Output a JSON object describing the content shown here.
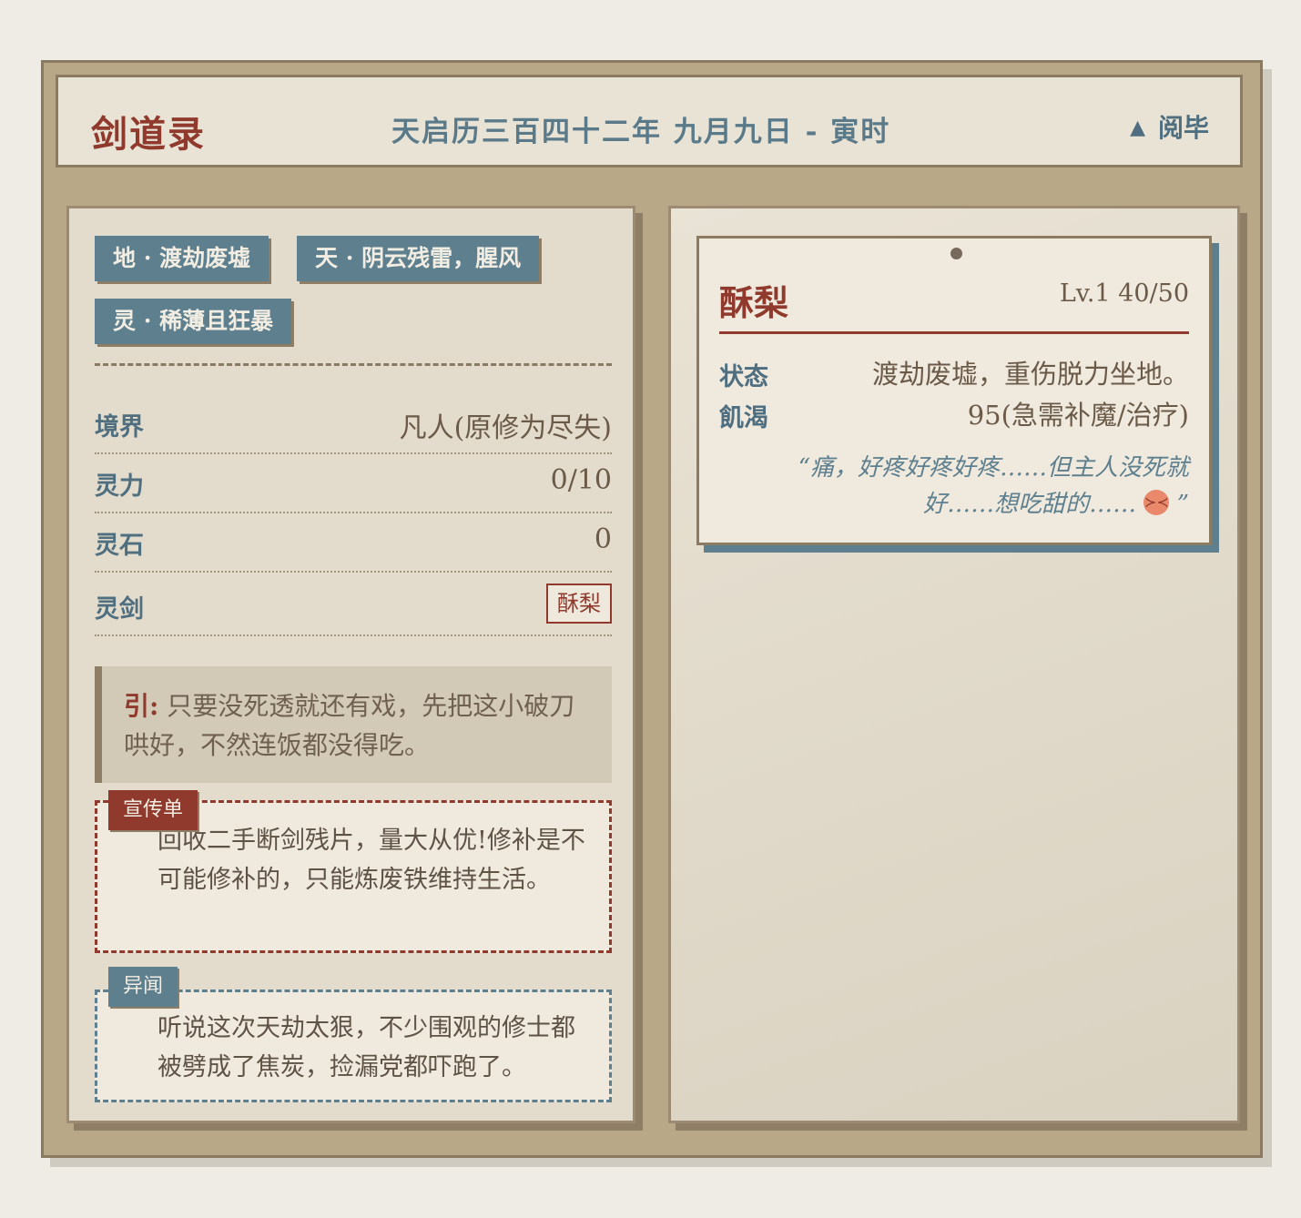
{
  "header": {
    "app_title": "剑道录",
    "date": "天启历三百四十二年 九月九日 - 寅时",
    "close_label": "阅毕",
    "close_icon": "triangle-up-icon"
  },
  "environment_tags": [
    "地 · 渡劫废墟",
    "天 · 阴云残雷，腥风",
    "灵 · 稀薄且狂暴"
  ],
  "stats": {
    "realm_label": "境界",
    "realm_value": "凡人(原修为尽失)",
    "power_label": "灵力",
    "power_value": "0/10",
    "stones_label": "灵石",
    "stones_value": "0",
    "sword_label": "灵剑",
    "sword_value": "酥梨"
  },
  "quote": {
    "prefix": "引:",
    "text": "只要没死透就还有戏，先把这小破刀哄好，不然连饭都没得吃。"
  },
  "notices": {
    "ad_tag": "宣传单",
    "ad_text": "回收二手断剑残片，量大从优!修补是不可能修补的，只能炼废铁维持生活。",
    "rumor_tag": "异闻",
    "rumor_text": "听说这次天劫太狠，不少围观的修士都被劈成了焦炭，捡漏党都吓跑了。"
  },
  "character": {
    "name": "酥梨",
    "level": "Lv.1 40/50",
    "status_label": "状态",
    "status_value": "渡劫废墟，重伤脱力坐地。",
    "hunger_label": "飢渴",
    "hunger_value": "95(急需补魔/治疗)",
    "quote_open": "“",
    "quote_text": "痛，好疼好疼好疼……但主人没死就好……想吃甜的……",
    "quote_emoji": "confounded-face-emoji",
    "quote_close": "”"
  },
  "colors": {
    "accent_red": "#8f3a2d",
    "accent_blue": "#5d7f8e",
    "frame": "#b8a888",
    "paper": "#e9e3d6"
  }
}
